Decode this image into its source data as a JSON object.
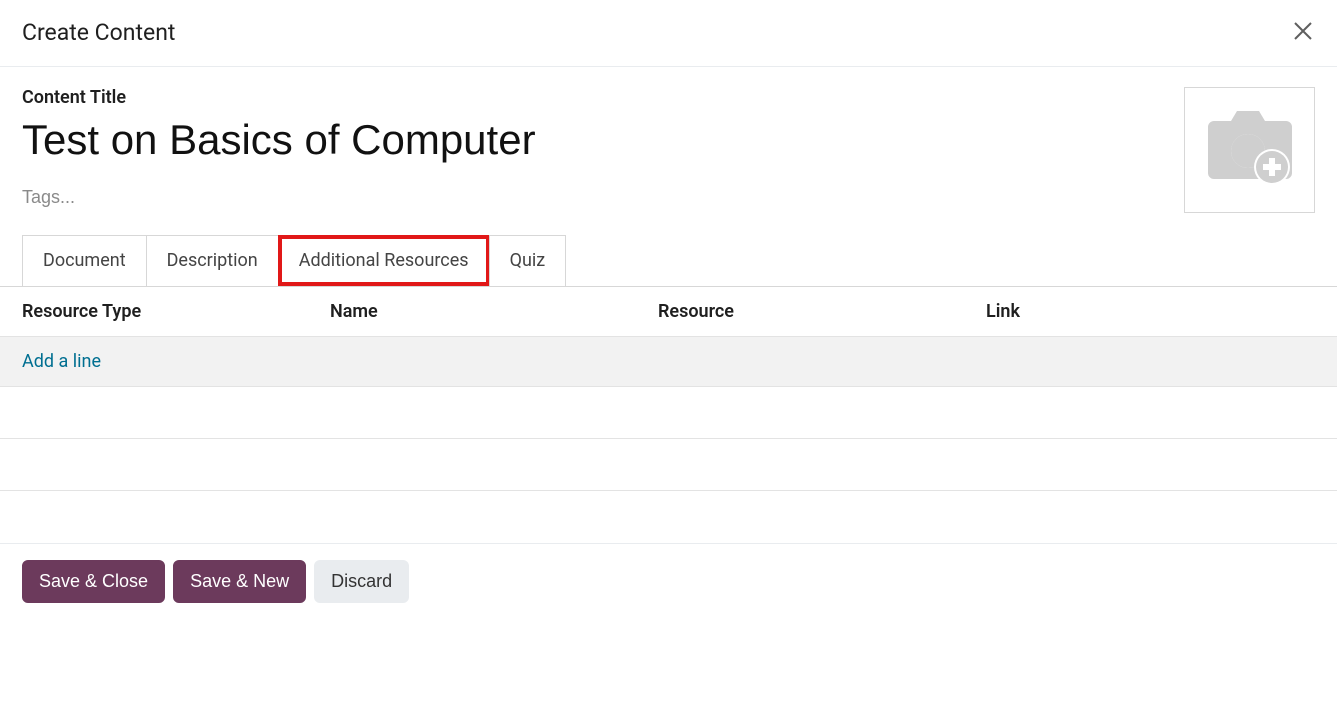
{
  "header": {
    "title": "Create Content"
  },
  "fields": {
    "title_label": "Content Title",
    "title_value": "Test on Basics of Computer",
    "tags_placeholder": "Tags..."
  },
  "tabs": [
    {
      "label": "Document",
      "active": false,
      "highlight": false
    },
    {
      "label": "Description",
      "active": false,
      "highlight": false
    },
    {
      "label": "Additional Resources",
      "active": true,
      "highlight": true
    },
    {
      "label": "Quiz",
      "active": false,
      "highlight": false
    }
  ],
  "table": {
    "columns": {
      "type": "Resource Type",
      "name": "Name",
      "resource": "Resource",
      "link": "Link"
    },
    "add_line_label": "Add a line"
  },
  "footer": {
    "save_close": "Save & Close",
    "save_new": "Save & New",
    "discard": "Discard"
  },
  "icons": {
    "close": "close-icon",
    "camera_add": "camera-add-icon"
  }
}
